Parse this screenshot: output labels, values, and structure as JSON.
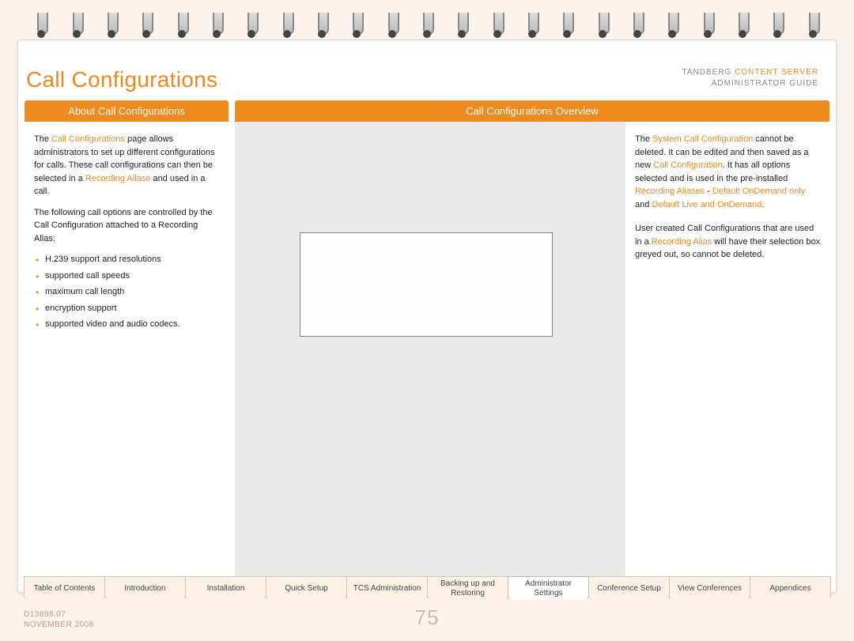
{
  "brand": {
    "line1a": "TANDBERG ",
    "line1b": "CONTENT SERVER",
    "line2": "ADMINISTRATOR GUIDE"
  },
  "title": "Call Configurations",
  "left": {
    "heading": "About Call Configurations",
    "para1a": "The ",
    "para1b": "Call Configurations",
    "para1c": " page allows administrators to set up different configurations for calls. These call configurations can then be selected in a ",
    "para1d": "Recording Aliase",
    "para1e": " and used in a call.",
    "para2": "The following call options are controlled by the Call Configuration attached to a Recording Alias:",
    "bullets": [
      "H.239 support and resolutions",
      "supported call speeds",
      "maximum call length",
      "encryption support",
      "supported video and audio codecs."
    ]
  },
  "right": {
    "heading": "Call Configurations Overview",
    "p1a": "The ",
    "p1b": "System Call Configuration",
    "p1c": " cannot be deleted. It can be edited and then saved as a new ",
    "p1d": "Call Configuration",
    "p1e": ". It has all options selected and is used in the pre-installed ",
    "p1f": "Recording Aliases",
    "p1g": " - ",
    "p1h": "Default OnDemand only",
    "p1i": " and ",
    "p1j": "Default Live and OnDemand",
    "p1k": ".",
    "p2a": "User created Call Configurations that are used in a ",
    "p2b": "Recording Alias",
    "p2c": " will have their selection box greyed out, so cannot be deleted."
  },
  "tabs": [
    "Table of Contents",
    "Introduction",
    "Installation",
    "Quick Setup",
    "TCS Administration",
    "Backing up and Restoring",
    "Administrator Settings",
    "Conference Setup",
    "View Conferences",
    "Appendices"
  ],
  "activeTabIndex": 6,
  "footer": {
    "doc": "D13898.07",
    "date": "NOVEMBER 2008",
    "page": "75"
  }
}
